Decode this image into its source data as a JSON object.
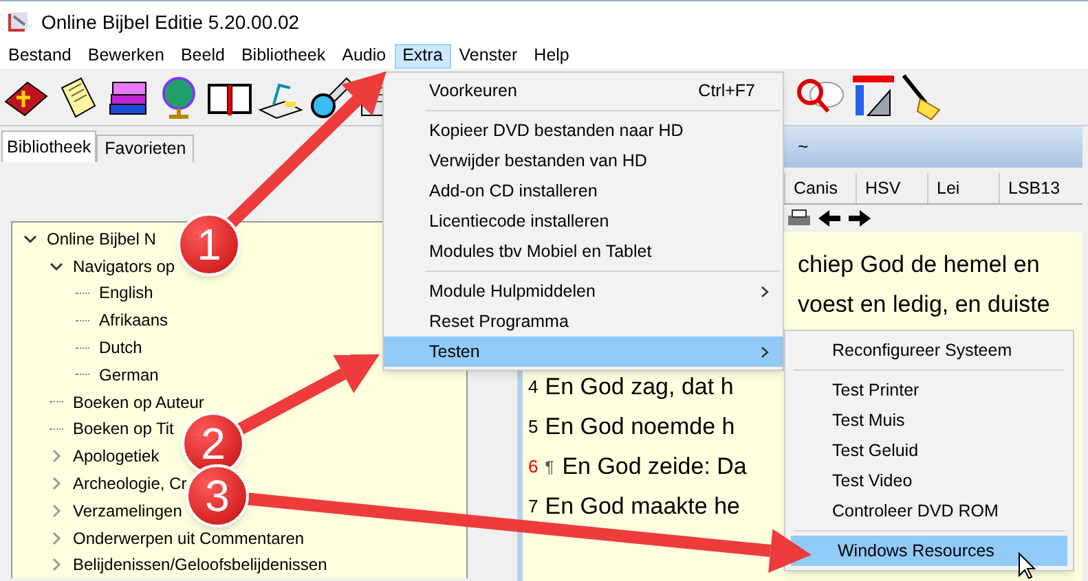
{
  "window": {
    "title": "Online Bijbel Editie 5.20.00.02"
  },
  "menu_bar": [
    {
      "label": "Bestand",
      "selected": false
    },
    {
      "label": "Bewerken",
      "selected": false
    },
    {
      "label": "Beeld",
      "selected": false
    },
    {
      "label": "Bibliotheek",
      "selected": false
    },
    {
      "label": "Audio",
      "selected": false
    },
    {
      "label": "Extra",
      "selected": true
    },
    {
      "label": "Venster",
      "selected": false
    },
    {
      "label": "Help",
      "selected": false
    }
  ],
  "left_tabs": [
    {
      "label": "Bibliotheek",
      "selected": true
    },
    {
      "label": "Favorieten",
      "selected": false
    }
  ],
  "tree": [
    {
      "label": "Online Bijbel N",
      "expanded": true,
      "children": [
        {
          "label": "Navigators op",
          "expanded": true,
          "children": [
            {
              "label": "English"
            },
            {
              "label": "Afrikaans"
            },
            {
              "label": "Dutch"
            },
            {
              "label": "German"
            }
          ]
        },
        {
          "label": "Boeken op Auteur"
        },
        {
          "label": "Boeken op Tit"
        },
        {
          "label": "Apologetiek",
          "expanded": false
        },
        {
          "label": "Archeologie, Cr",
          "expanded": false
        },
        {
          "label": "Verzamelingen",
          "expanded": false
        },
        {
          "label": "Onderwerpen uit Commentaren",
          "expanded": false
        },
        {
          "label": "Belijdenissen/Geloofsbelijdenissen",
          "expanded": false
        }
      ]
    }
  ],
  "reader": {
    "title": "~",
    "tabs": [
      {
        "label": "Canis"
      },
      {
        "label": "HSV"
      },
      {
        "label": "Lei"
      },
      {
        "label": "LSB13"
      }
    ],
    "verses": [
      {
        "text": "chiep God de hemel en"
      },
      {
        "text": "voest en ledig, en duiste"
      },
      {
        "number": "4",
        "text": "En God zag, dat h",
        "emphasized": false
      },
      {
        "number": "5",
        "text": "En God noemde h",
        "emphasized": false
      },
      {
        "number": "6",
        "pilcrow": "¶",
        "text": "En God zeide: Da",
        "emphasized": true
      },
      {
        "number": "7",
        "text": "En God maakte he",
        "emphasized": false
      }
    ]
  },
  "extra_menu": [
    [
      {
        "label": "Voorkeuren",
        "shortcut": "Ctrl+F7",
        "submenu": false,
        "selected": false
      }
    ],
    [
      {
        "label": "Kopieer DVD bestanden naar HD",
        "submenu": false,
        "selected": false
      },
      {
        "label": "Verwijder bestanden van HD",
        "submenu": false,
        "selected": false
      },
      {
        "label": "Add-on CD installeren",
        "submenu": false,
        "selected": false
      },
      {
        "label": "Licentiecode installeren",
        "submenu": false,
        "selected": false
      },
      {
        "label": "Modules tbv Mobiel en Tablet",
        "submenu": false,
        "selected": false
      }
    ],
    [
      {
        "label": "Module Hulpmiddelen",
        "submenu": true,
        "selected": false
      },
      {
        "label": "Reset Programma",
        "submenu": false,
        "selected": false
      },
      {
        "label": "Testen",
        "submenu": true,
        "selected": true
      }
    ]
  ],
  "testen_submenu": [
    [
      {
        "label": "Reconfigureer Systeem",
        "selected": false
      }
    ],
    [
      {
        "label": "Test Printer",
        "selected": false
      },
      {
        "label": "Test Muis",
        "selected": false
      },
      {
        "label": "Test Geluid",
        "selected": false
      },
      {
        "label": "Test Video",
        "selected": false
      },
      {
        "label": "Controleer DVD ROM",
        "selected": false
      }
    ],
    [
      {
        "label": "Windows Resources",
        "selected": true
      }
    ]
  ],
  "callouts": [
    {
      "number": "1"
    },
    {
      "number": "2"
    },
    {
      "number": "3"
    }
  ]
}
